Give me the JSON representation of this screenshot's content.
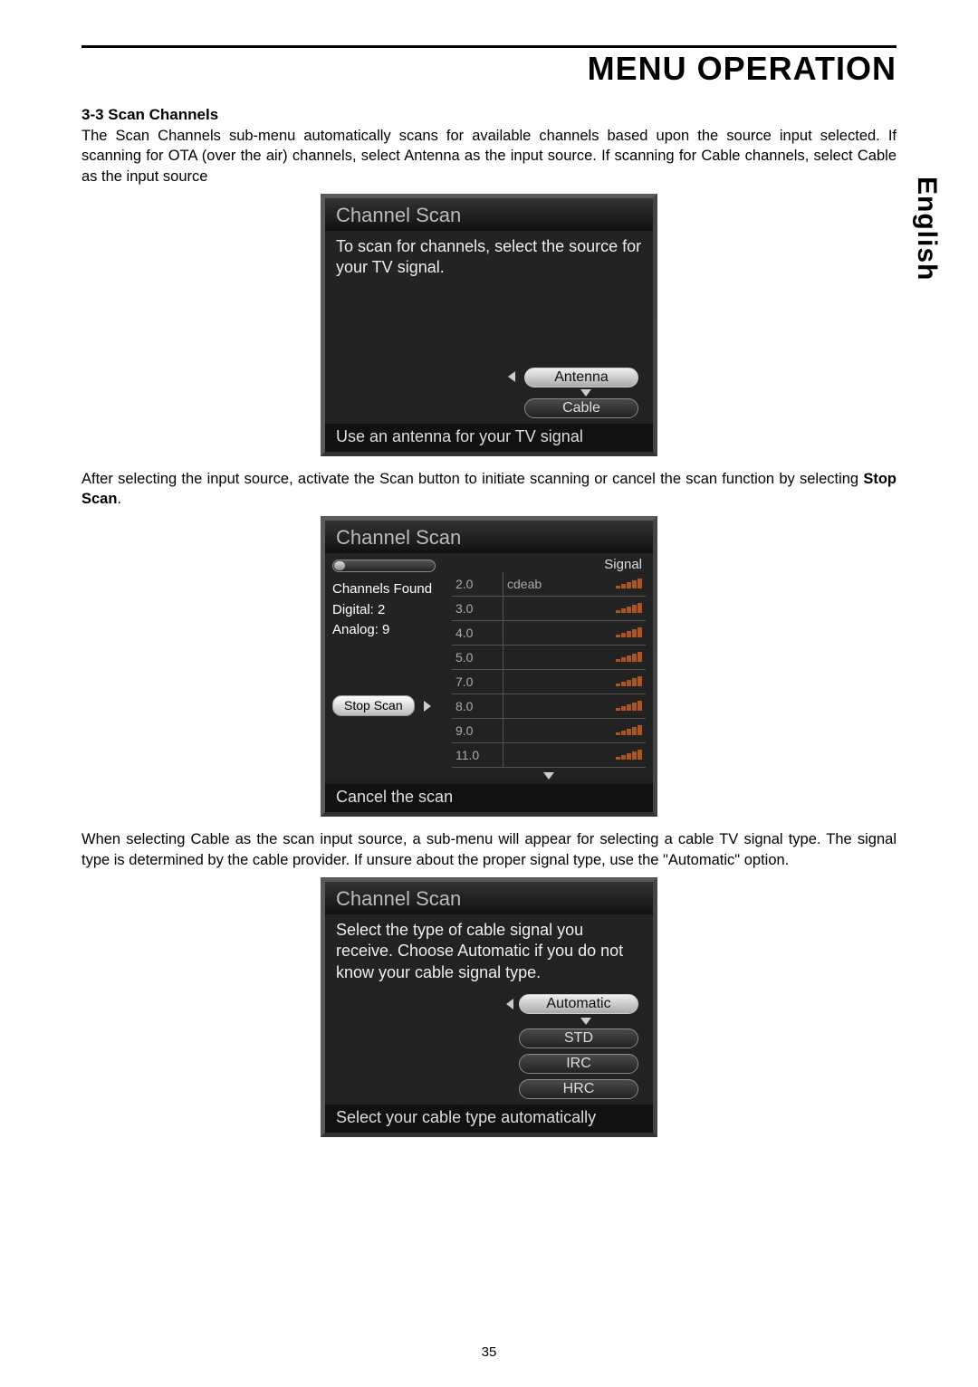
{
  "header": {
    "title": "MENU OPERATION"
  },
  "language_tab": "English",
  "section": {
    "heading": "3-3  Scan Channels",
    "para1": "The Scan Channels sub-menu automatically scans for available channels based upon the source input selected. If scanning for OTA (over the air) channels, select Antenna as the input source. If scanning for Cable channels, select Cable as the input source",
    "para2_pre": "After selecting the input source, activate the Scan button to initiate scanning or cancel the scan function by selecting ",
    "para2_bold": "Stop Scan",
    "para2_post": ".",
    "para3": "When selecting Cable as the scan input source, a sub-menu will appear for selecting a cable TV signal type. The signal type is determined by the cable provider. If unsure about the proper signal type, use the \"Automatic\" option."
  },
  "dialog1": {
    "title": "Channel Scan",
    "instruction": "To scan for channels, select the source for your TV signal.",
    "options": {
      "selected": "Antenna",
      "other": "Cable"
    },
    "footer": "Use an antenna for your TV signal"
  },
  "dialog2": {
    "title": "Channel Scan",
    "signal_label": "Signal",
    "left": {
      "channels_found": "Channels Found",
      "digital_label": "Digital:",
      "digital_count": "2",
      "analog_label": "Analog:",
      "analog_count": "9",
      "stop_btn": "Stop Scan"
    },
    "rows": [
      {
        "num": "2.0",
        "name": "cdeab"
      },
      {
        "num": "3.0",
        "name": ""
      },
      {
        "num": "4.0",
        "name": ""
      },
      {
        "num": "5.0",
        "name": ""
      },
      {
        "num": "7.0",
        "name": ""
      },
      {
        "num": "8.0",
        "name": ""
      },
      {
        "num": "9.0",
        "name": ""
      },
      {
        "num": "11.0",
        "name": ""
      }
    ],
    "footer": "Cancel the scan"
  },
  "dialog3": {
    "title": "Channel Scan",
    "instruction": "Select the type of cable signal you receive. Choose Automatic if you do not know your cable signal type.",
    "options": {
      "selected": "Automatic",
      "others": [
        "STD",
        "IRC",
        "HRC"
      ]
    },
    "footer": "Select your cable type automatically"
  },
  "page_number": "35"
}
